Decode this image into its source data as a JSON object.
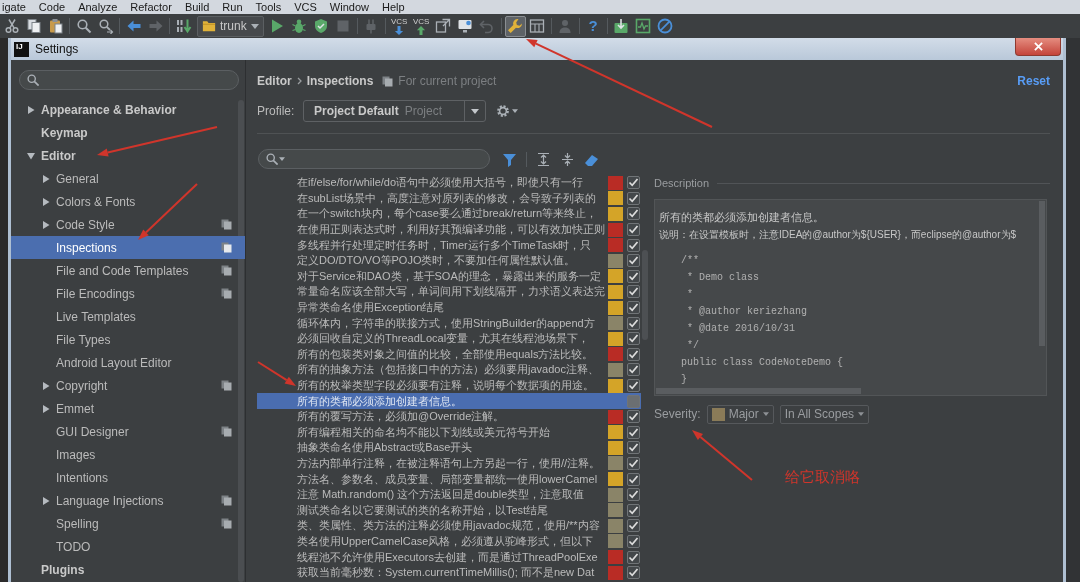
{
  "menu_bar": {
    "items": [
      "igate",
      "Code",
      "Analyze",
      "Refactor",
      "Build",
      "Run",
      "Tools",
      "VCS",
      "Window",
      "Help"
    ]
  },
  "toolbar": {
    "groups": [
      [
        {
          "kind": "cut",
          "disabled": false,
          "pressed": false
        },
        {
          "kind": "copy",
          "disabled": false,
          "pressed": false
        },
        {
          "kind": "paste",
          "disabled": false,
          "pressed": false
        }
      ],
      [
        {
          "kind": "find",
          "disabled": false,
          "pressed": false
        },
        {
          "kind": "replace",
          "disabled": false,
          "pressed": false
        }
      ],
      [
        {
          "kind": "back",
          "disabled": false,
          "pressed": false
        },
        {
          "kind": "forward",
          "disabled": true,
          "pressed": false
        }
      ],
      [
        {
          "kind": "make",
          "disabled": false,
          "pressed": false
        },
        {
          "kind": "run_config",
          "label": "trunk",
          "disabled": false,
          "pressed": false
        },
        {
          "kind": "run",
          "disabled": false,
          "pressed": false
        },
        {
          "kind": "debug",
          "disabled": false,
          "pressed": false
        },
        {
          "kind": "coverage",
          "disabled": false,
          "pressed": false
        },
        {
          "kind": "stop",
          "disabled": true,
          "pressed": false
        }
      ],
      [
        {
          "kind": "attach",
          "disabled": true,
          "pressed": false
        }
      ],
      [
        {
          "kind": "vcs_update",
          "label": "VCS",
          "disabled": false,
          "pressed": false
        },
        {
          "kind": "vcs_commit",
          "label": "VCS",
          "disabled": false,
          "pressed": false
        },
        {
          "kind": "vcs_compare",
          "disabled": false,
          "pressed": false
        },
        {
          "kind": "vcs_changes",
          "disabled": false,
          "pressed": false
        },
        {
          "kind": "revert",
          "disabled": true,
          "pressed": false
        }
      ],
      [
        {
          "kind": "settings",
          "disabled": false,
          "pressed": true
        },
        {
          "kind": "project_structure",
          "disabled": false,
          "pressed": false
        }
      ],
      [
        {
          "kind": "account",
          "disabled": true,
          "pressed": false
        }
      ],
      [
        {
          "kind": "help",
          "label": "?",
          "disabled": false,
          "pressed": false
        }
      ],
      [
        {
          "kind": "sdk_manager",
          "disabled": false,
          "pressed": false
        },
        {
          "kind": "device_monitor",
          "disabled": false,
          "pressed": false
        },
        {
          "kind": "power_save",
          "disabled": false,
          "pressed": false
        }
      ]
    ]
  },
  "window": {
    "title": "Settings",
    "logo": "IJ"
  },
  "settings_tree": {
    "items": [
      {
        "label": "Appearance & Behavior",
        "expanded": false,
        "selected": false,
        "project_level": false
      },
      {
        "label": "Keymap",
        "selected": false,
        "project_level": false
      },
      {
        "label": "Editor",
        "expanded": true,
        "selected": false,
        "project_level": false,
        "children": [
          {
            "label": "General",
            "expanded": false,
            "selected": false,
            "project_level": false
          },
          {
            "label": "Colors & Fonts",
            "expanded": false,
            "selected": false,
            "project_level": false
          },
          {
            "label": "Code Style",
            "expanded": false,
            "selected": false,
            "project_level": true
          },
          {
            "label": "Inspections",
            "selected": true,
            "project_level": true
          },
          {
            "label": "File and Code Templates",
            "selected": false,
            "project_level": true
          },
          {
            "label": "File Encodings",
            "selected": false,
            "project_level": true
          },
          {
            "label": "Live Templates",
            "selected": false,
            "project_level": false
          },
          {
            "label": "File Types",
            "selected": false,
            "project_level": false
          },
          {
            "label": "Android Layout Editor",
            "selected": false,
            "project_level": false
          },
          {
            "label": "Copyright",
            "expanded": false,
            "selected": false,
            "project_level": true
          },
          {
            "label": "Emmet",
            "expanded": false,
            "selected": false,
            "project_level": false
          },
          {
            "label": "GUI Designer",
            "selected": false,
            "project_level": true
          },
          {
            "label": "Images",
            "selected": false,
            "project_level": false
          },
          {
            "label": "Intentions",
            "selected": false,
            "project_level": false
          },
          {
            "label": "Language Injections",
            "expanded": false,
            "selected": false,
            "project_level": true
          },
          {
            "label": "Spelling",
            "selected": false,
            "project_level": true
          },
          {
            "label": "TODO",
            "selected": false,
            "project_level": false
          }
        ]
      },
      {
        "label": "Plugins",
        "selected": false,
        "project_level": false
      }
    ]
  },
  "breadcrumb": {
    "items": [
      "Editor",
      "Inspections"
    ],
    "scope_note": "For current project",
    "reset": "Reset"
  },
  "profile": {
    "label": "Profile:",
    "value": "Project Default",
    "scope": "Project"
  },
  "inspections": {
    "rows": [
      {
        "text": "在if/else/for/while/do语句中必须使用大括号，即使只有一行",
        "color": "#b92c25",
        "checked": true,
        "selected": false
      },
      {
        "text": "在subList场景中，高度注意对原列表的修改，会导致子列表的",
        "color": "#d4a428",
        "checked": true,
        "selected": false
      },
      {
        "text": "在一个switch块内，每个case要么通过break/return等来终止，",
        "color": "#d4a428",
        "checked": true,
        "selected": false
      },
      {
        "text": "在使用正则表达式时，利用好其预编译功能，可以有效加快正则",
        "color": "#b92c25",
        "checked": true,
        "selected": false
      },
      {
        "text": "多线程并行处理定时任务时，Timer运行多个TimeTask时，只",
        "color": "#b92c25",
        "checked": true,
        "selected": false
      },
      {
        "text": "定义DO/DTO/VO等POJO类时，不要加任何属性默认值。",
        "color": "#8a8468",
        "checked": true,
        "selected": false
      },
      {
        "text": "对于Service和DAO类，基于SOA的理念，暴露出来的服务一定",
        "color": "#d4a428",
        "checked": true,
        "selected": false
      },
      {
        "text": "常量命名应该全部大写，单词间用下划线隔开，力求语义表达完",
        "color": "#d4a428",
        "checked": true,
        "selected": false
      },
      {
        "text": "异常类命名使用Exception结尾",
        "color": "#d4a428",
        "checked": true,
        "selected": false
      },
      {
        "text": "循环体内，字符串的联接方式，使用StringBuilder的append方",
        "color": "#8a8468",
        "checked": true,
        "selected": false
      },
      {
        "text": "必须回收自定义的ThreadLocal变量，尤其在线程池场景下，",
        "color": "#d4a428",
        "checked": true,
        "selected": false
      },
      {
        "text": "所有的包装类对象之间值的比较，全部使用equals方法比较。",
        "color": "#b92c25",
        "checked": true,
        "selected": false
      },
      {
        "text": "所有的抽象方法（包括接口中的方法）必须要用javadoc注释、",
        "color": "#8a8468",
        "checked": true,
        "selected": false
      },
      {
        "text": "所有的枚举类型字段必须要有注释，说明每个数据项的用途。",
        "color": "#d4a428",
        "checked": true,
        "selected": false
      },
      {
        "text": "所有的类都必须添加创建者信息。",
        "checked": false,
        "selected": true
      },
      {
        "text": "所有的覆写方法，必须加@Override注解。",
        "color": "#b92c25",
        "checked": true,
        "selected": false
      },
      {
        "text": "所有编程相关的命名均不能以下划线或美元符号开始",
        "color": "#d4a428",
        "checked": true,
        "selected": false
      },
      {
        "text": "抽象类命名使用Abstract或Base开头",
        "color": "#d4a428",
        "checked": true,
        "selected": false
      },
      {
        "text": "方法内部单行注释，在被注释语句上方另起一行，使用//注释。",
        "color": "#8a8468",
        "checked": true,
        "selected": false
      },
      {
        "text": "方法名、参数名、成员变量、局部变量都统一使用lowerCamel",
        "color": "#d4a428",
        "checked": true,
        "selected": false
      },
      {
        "text": "注意 Math.random() 这个方法返回是double类型，注意取值",
        "color": "#8a8468",
        "checked": true,
        "selected": false
      },
      {
        "text": "测试类命名以它要测试的类的名称开始，以Test结尾",
        "color": "#8a8468",
        "checked": true,
        "selected": false
      },
      {
        "text": "类、类属性、类方法的注释必须使用javadoc规范，使用/**内容",
        "color": "#8a8468",
        "checked": true,
        "selected": false
      },
      {
        "text": "类名使用UpperCamelCase风格，必须遵从驼峰形式，但以下",
        "color": "#8a8468",
        "checked": true,
        "selected": false
      },
      {
        "text": "线程池不允许使用Executors去创建，而是通过ThreadPoolExe",
        "color": "#b92c25",
        "checked": true,
        "selected": false
      },
      {
        "text": "获取当前毫秒数：System.currentTimeMillis(); 而不是new Dat",
        "color": "#b92c25",
        "checked": true,
        "selected": false
      }
    ]
  },
  "description": {
    "title": "Description",
    "summary": "所有的类都必须添加创建者信息。",
    "note": "说明：在设置模板时，注意IDEA的@author为${USER}，而eclipse的@author为$",
    "code": [
      "/**",
      " * Demo class",
      " *",
      " * @author keriezhang",
      " * @date 2016/10/31",
      " */",
      "public class CodeNoteDemo {",
      "}"
    ]
  },
  "severity": {
    "label": "Severity:",
    "value": "Major",
    "color": "#8a7b58",
    "scope": "In All Scopes"
  },
  "annotations": {
    "note": "给它取消咯"
  }
}
